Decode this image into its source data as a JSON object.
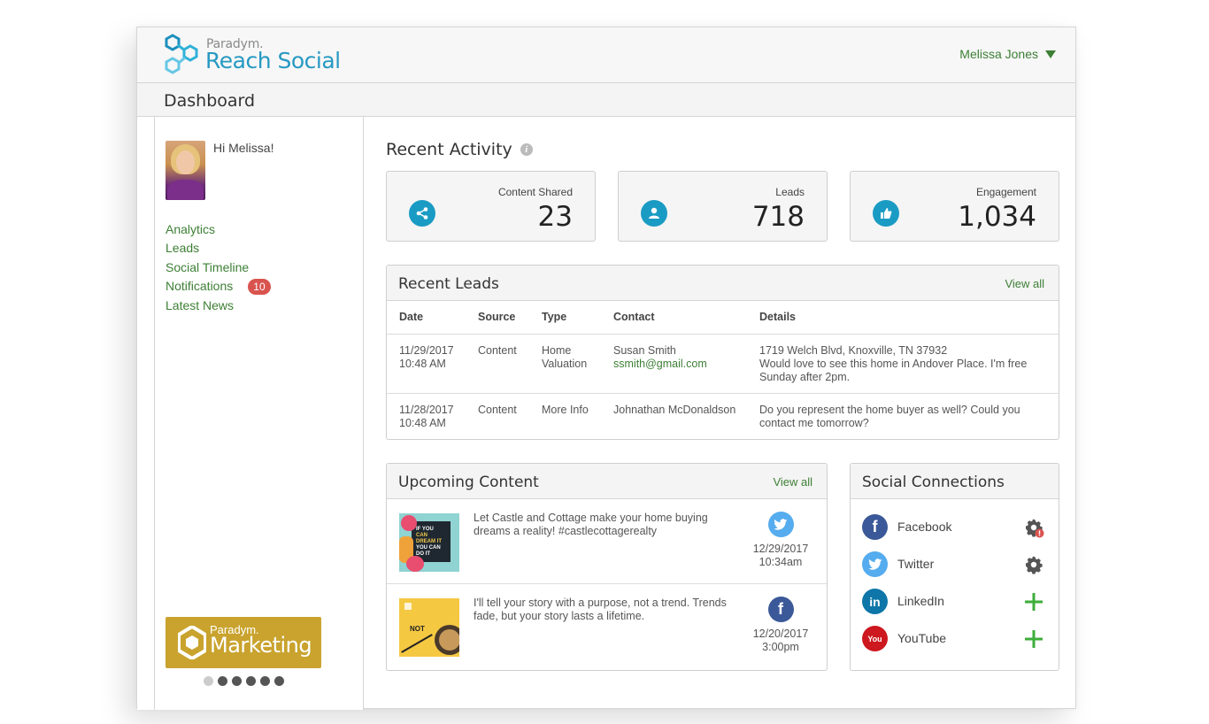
{
  "header": {
    "brand_small": "Paradym.",
    "brand_big": "Reach Social",
    "user_name": "Melissa Jones"
  },
  "page": {
    "title": "Dashboard"
  },
  "sidebar": {
    "greeting": "Hi Melissa!",
    "items": [
      {
        "label": "Analytics"
      },
      {
        "label": "Leads"
      },
      {
        "label": "Social Timeline"
      },
      {
        "label": "Notifications",
        "badge": "10"
      },
      {
        "label": "Latest News"
      }
    ],
    "promo": {
      "small": "Paradym.",
      "big": "Marketing"
    },
    "carousel_dots": 6,
    "carousel_active_index": 0
  },
  "recent_activity": {
    "title": "Recent Activity",
    "stats": [
      {
        "label": "Content Shared",
        "value": "23",
        "icon": "share-icon"
      },
      {
        "label": "Leads",
        "value": "718",
        "icon": "user-icon"
      },
      {
        "label": "Engagement",
        "value": "1,034",
        "icon": "thumbs-up-icon"
      }
    ]
  },
  "recent_leads": {
    "title": "Recent Leads",
    "view_all": "View all",
    "columns": [
      "Date",
      "Source",
      "Type",
      "Contact",
      "Details"
    ],
    "rows": [
      {
        "date": "11/29/2017",
        "time": "10:48 AM",
        "source": "Content",
        "type_line1": "Home",
        "type_line2": "Valuation",
        "contact_name": "Susan Smith",
        "contact_email": "ssmith@gmail.com",
        "details": "1719 Welch Blvd, Knoxville, TN 37932",
        "details2": "Would love to see this home in Andover Place. I'm free Sunday after 2pm."
      },
      {
        "date": "11/28/2017",
        "time": "10:48 AM",
        "source": "Content",
        "type_line1": "More Info",
        "type_line2": "",
        "contact_name": "Johnathan McDonaldson",
        "contact_email": "",
        "details": "Do you represent the home buyer as well? Could you contact me tomorrow?",
        "details2": ""
      }
    ]
  },
  "upcoming_content": {
    "title": "Upcoming Content",
    "view_all": "View all",
    "items": [
      {
        "text": "Let Castle and Cottage make your home buying dreams a reality! #castlecottagerealty",
        "network": "twitter",
        "date": "12/29/2017",
        "time": "10:34am",
        "thumb_text": [
          "IF YOU",
          "CAN",
          "DREAM IT",
          "YOU CAN",
          "DO IT"
        ]
      },
      {
        "text": "I'll tell your story with a purpose, not a trend. Trends fade, but your story lasts a lifetime.",
        "network": "facebook",
        "date": "12/20/2017",
        "time": "3:00pm",
        "thumb_text": [
          "NOT"
        ]
      }
    ]
  },
  "social_connections": {
    "title": "Social Connections",
    "items": [
      {
        "name": "Facebook",
        "action": "settings-alert",
        "color": "#3b5998"
      },
      {
        "name": "Twitter",
        "action": "settings",
        "color": "#55acee"
      },
      {
        "name": "LinkedIn",
        "action": "add",
        "color": "#0e76a8"
      },
      {
        "name": "YouTube",
        "action": "add",
        "color": "#cc181e"
      }
    ]
  },
  "colors": {
    "accent_blue": "#1a9bc4",
    "link_green": "#3d7f35",
    "badge_red": "#d9534f",
    "promo_gold": "#c9a32e"
  }
}
